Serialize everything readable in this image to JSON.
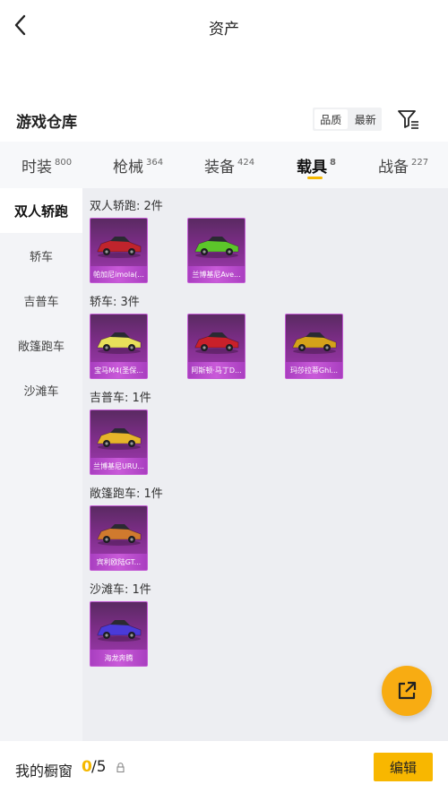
{
  "header": {
    "title": "资产"
  },
  "warehouse": {
    "title": "游戏仓库",
    "sort_options": [
      "品质",
      "最新"
    ],
    "filter_icon": "filter-icon"
  },
  "tabs": [
    {
      "label": "时装",
      "count": "800"
    },
    {
      "label": "枪械",
      "count": "364"
    },
    {
      "label": "装备",
      "count": "424"
    },
    {
      "label": "载具",
      "count": "8",
      "active": true
    },
    {
      "label": "战备",
      "count": "227"
    }
  ],
  "sidebar": {
    "items": [
      "双人轿跑",
      "轿车",
      "吉普车",
      "敞篷跑车",
      "沙滩车"
    ],
    "active_index": 0
  },
  "groups": [
    {
      "title": "双人轿跑: 2件",
      "items": [
        {
          "name": "帕加尼imola(...",
          "color": "#c0242c"
        },
        {
          "name": "兰博基尼Ave...",
          "color": "#5cc62a"
        }
      ]
    },
    {
      "title": "轿车: 3件",
      "items": [
        {
          "name": "宝马M4(圣保...",
          "color": "#e8e05a"
        },
        {
          "name": "阿斯顿·马丁D...",
          "color": "#c9202a"
        },
        {
          "name": "玛莎拉蒂Ghi...",
          "color": "#d4a21a"
        }
      ]
    },
    {
      "title": "吉普车: 1件",
      "items": [
        {
          "name": "兰博基尼URU...",
          "color": "#e6b52a"
        }
      ]
    },
    {
      "title": "敞篷跑车: 1件",
      "items": [
        {
          "name": "宾利欧陆GT...",
          "color": "#d07a2e"
        }
      ]
    },
    {
      "title": "沙滩车: 1件",
      "items": [
        {
          "name": "海龙奔腾",
          "color": "#4a3ad8"
        }
      ]
    }
  ],
  "bottom": {
    "showcase_label": "我的橱窗",
    "current": "0",
    "total": "/5",
    "edit_label": "编辑"
  },
  "colors": {
    "accent": "#f8b700",
    "card_purple": "#7b2d86"
  }
}
